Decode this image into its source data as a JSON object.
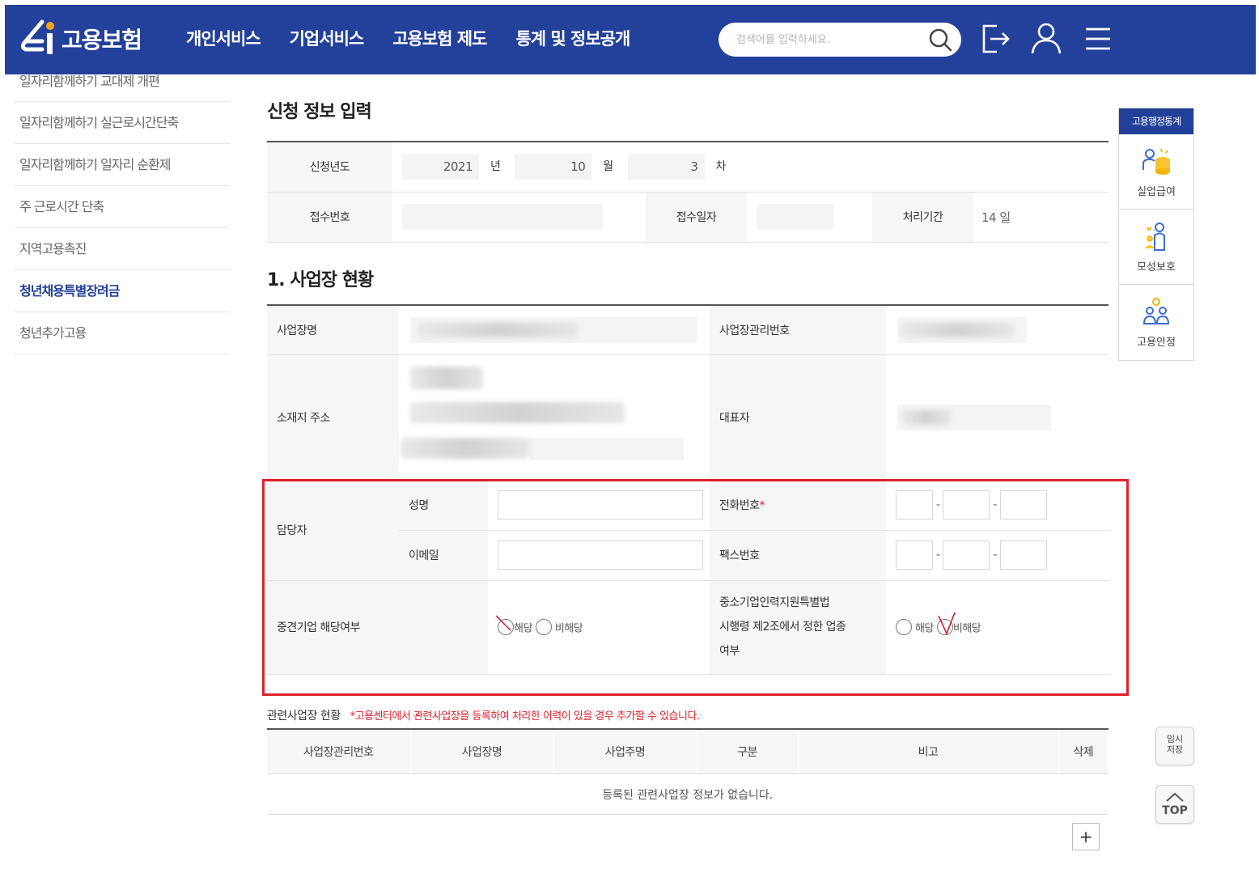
{
  "header": {
    "logo_text": "고용보험",
    "nav": [
      "개인서비스",
      "기업서비스",
      "고용보험 제도",
      "통계 및 정보공개"
    ],
    "search_placeholder": "검색어를 입력하세요.",
    "brand_color": "#23419a"
  },
  "sidebar": {
    "items": [
      {
        "label": "일자리함께하기 교대제 개편",
        "active": false
      },
      {
        "label": "일자리함께하기 실근로시간단축",
        "active": false
      },
      {
        "label": "일자리함께하기 일자리 순환제",
        "active": false
      },
      {
        "label": "주 근로시간 단축",
        "active": false
      },
      {
        "label": "지역고용촉진",
        "active": false
      },
      {
        "label": "청년채용특별장려금",
        "active": true
      },
      {
        "label": "청년추가고용",
        "active": false
      }
    ]
  },
  "application": {
    "title": "신청 정보 입력",
    "year_label": "신청년도",
    "year": "2021",
    "year_unit": "년",
    "month": "10",
    "month_unit": "월",
    "round": "3",
    "round_unit": "차",
    "receipt_no_label": "접수번호",
    "receipt_date_label": "접수일자",
    "period_label": "처리기간",
    "period_value": "14 일"
  },
  "workplace": {
    "title": "1. 사업장 현황",
    "name_label": "사업장명",
    "mgmt_no_label": "사업장관리번호",
    "address_label": "소재지 주소",
    "rep_label": "대표자",
    "contact_label": "담당자",
    "contact_name_label": "성명",
    "email_label": "이메일",
    "phone_label": "전화번호",
    "required_mark": "*",
    "fax_label": "팩스번호",
    "phone_sep": "-",
    "midsize_label": "중견기업 해당여부",
    "sme_industry_label_1": "중소기업인력지원특별법",
    "sme_industry_label_2": "시행령 제2조에서 정한 업종",
    "sme_industry_label_3": "여부",
    "yes_label": "해당",
    "no_label": "비해당"
  },
  "related": {
    "title": "관련사업장 현황",
    "note": "*고용센터에서 관련사업장을 등록하여 처리한 이력이 있을 경우 추가할 수 있습니다.",
    "columns": [
      "사업장관리번호",
      "사업장명",
      "사업주명",
      "구분",
      "비고",
      "삭제"
    ],
    "empty_message": "등록된 관련사업장 정보가 없습니다.",
    "add_label": "+"
  },
  "quick_menu": {
    "title": "고용행정통계",
    "items": [
      {
        "label": "실업급여",
        "icon": "coin-person-icon"
      },
      {
        "label": "모성보호",
        "icon": "mother-icon"
      },
      {
        "label": "고용안정",
        "icon": "people-icon"
      }
    ]
  },
  "floating": {
    "temp_save_1": "임시",
    "temp_save_2": "저장",
    "top_label": "TOP"
  },
  "highlight_color": "#e0202b"
}
